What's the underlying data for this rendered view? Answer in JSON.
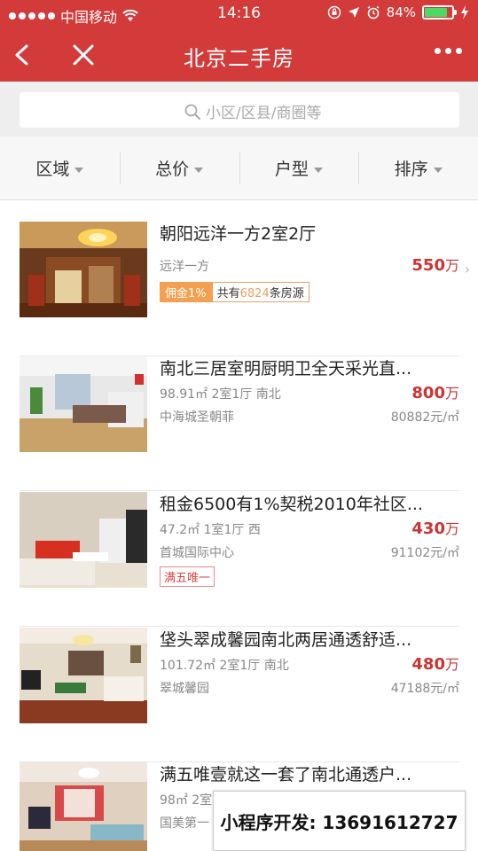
{
  "status": {
    "carrier": "中国移动",
    "time": "14:16",
    "battery_pct": "84%",
    "battery_level": 0.84
  },
  "nav": {
    "title": "北京二手房"
  },
  "search": {
    "placeholder": "小区/区县/商圈等"
  },
  "filters": [
    "区域",
    "总价",
    "户型",
    "排序"
  ],
  "listings": [
    {
      "title": "朝阳远洋一方2室2厅",
      "community": "远洋一方",
      "price": "550",
      "price_unit": "万",
      "tag_commission": "佣金1%",
      "tag_sources_prefix": "共有",
      "tag_sources_count": "6824",
      "tag_sources_suffix": "条房源"
    },
    {
      "title": "南北三居室明厨明卫全天采光直...",
      "specs": "98.91㎡  2室1厅  南北",
      "community": "中海城圣朝菲",
      "price": "800",
      "price_unit": "万",
      "unit_price": "80882元/㎡"
    },
    {
      "title": "租金6500有1%契税2010年社区...",
      "specs": "47.2㎡  1室1厅  西",
      "community": "首城国际中心",
      "price": "430",
      "price_unit": "万",
      "unit_price": "91102元/㎡",
      "tag": "满五唯一"
    },
    {
      "title": "垡头翠成馨园南北两居通透舒适...",
      "specs": "101.72㎡  2室1厅  南北",
      "community": "翠城馨园",
      "price": "480",
      "price_unit": "万",
      "unit_price": "47188元/㎡"
    },
    {
      "title": "满五唯壹就这一套了南北通透户...",
      "specs": "98㎡  2室",
      "community": "国美第一"
    }
  ],
  "promo": "小程序开发: 13691612727",
  "colors": {
    "brand": "#d33a3a",
    "price": "#cc3333",
    "tag_orange": "#f5a050"
  }
}
